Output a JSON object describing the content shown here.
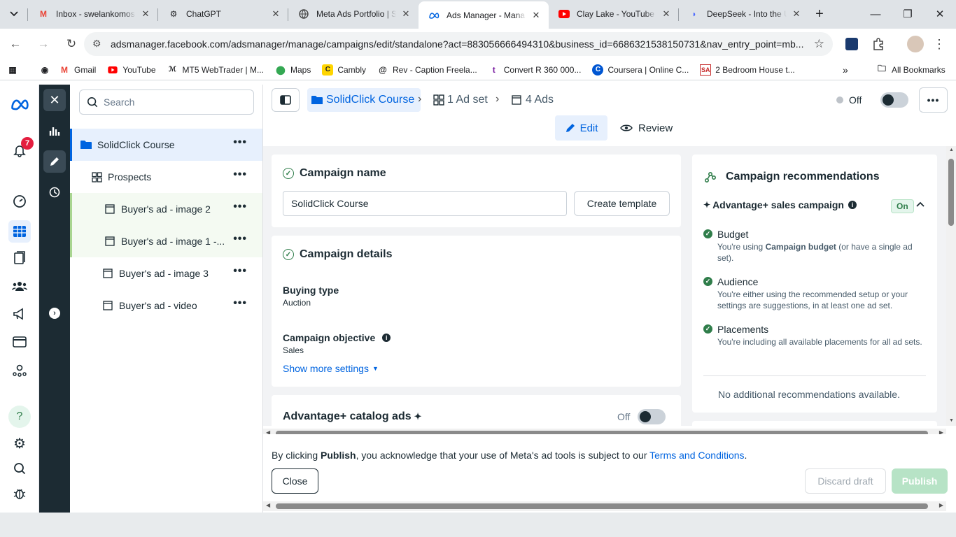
{
  "browser": {
    "tabs": [
      {
        "title": "Inbox - swelankomos",
        "icon": "gmail-icon"
      },
      {
        "title": "ChatGPT",
        "icon": "chatgpt-icon"
      },
      {
        "title": "Meta Ads Portfolio | S",
        "icon": "globe-icon"
      },
      {
        "title": "Ads Manager - Mana",
        "icon": "meta-icon"
      },
      {
        "title": "Clay Lake - YouTube",
        "icon": "youtube-icon"
      },
      {
        "title": "DeepSeek - Into the U",
        "icon": "deepseek-icon"
      }
    ],
    "url": "adsmanager.facebook.com/adsmanager/manage/campaigns/edit/standalone?act=883056666494310&business_id=6686321538150731&nav_entry_point=mb...",
    "bookmarks": [
      "Gmail",
      "YouTube",
      "MT5 WebTrader | M...",
      "Maps",
      "Cambly",
      "Rev - Caption Freela...",
      "Convert R 360 000...",
      "Coursera | Online C...",
      "2 Bedroom House t..."
    ],
    "all_bookmarks": "All Bookmarks"
  },
  "rail": {
    "notifications_count": "7"
  },
  "tree": {
    "search_placeholder": "Search",
    "items": [
      {
        "label": "SolidClick Course"
      },
      {
        "label": "Prospects"
      },
      {
        "label": "Buyer's ad - image 2"
      },
      {
        "label": "Buyer's ad - image 1 -..."
      },
      {
        "label": "Buyer's ad - image 3"
      },
      {
        "label": "Buyer's ad - video"
      }
    ]
  },
  "header": {
    "campaign": "SolidClick Course",
    "adset": "1 Ad set",
    "ads": "4 Ads",
    "status": "Off",
    "edit": "Edit",
    "review": "Review"
  },
  "campaign_name": {
    "title": "Campaign name",
    "value": "SolidClick Course",
    "create_template": "Create template"
  },
  "campaign_details": {
    "title": "Campaign details",
    "buying_type_label": "Buying type",
    "buying_type": "Auction",
    "objective_label": "Campaign objective",
    "objective": "Sales",
    "show_more": "Show more settings"
  },
  "catalog": {
    "title": "Advantage+ catalog ads",
    "status": "Off"
  },
  "recommendations": {
    "title": "Campaign recommendations",
    "subtitle": "Advantage+ sales campaign",
    "badge": "On",
    "items": [
      {
        "title": "Budget",
        "desc_pre": "You're using ",
        "desc_bold": "Campaign budget",
        "desc_post": " (or have a single ad set)."
      },
      {
        "title": "Audience",
        "desc": "You're either using the recommended setup or your settings are suggestions, in at least one ad set."
      },
      {
        "title": "Placements",
        "desc": "You're including all available placements for all ad sets."
      }
    ],
    "none": "No additional recommendations available."
  },
  "footer": {
    "notice_pre": "By clicking ",
    "notice_bold": "Publish",
    "notice_mid": ", you acknowledge that your use of Meta's ad tools is subject to our ",
    "notice_link": "Terms and Conditions",
    "notice_end": ".",
    "close": "Close",
    "discard": "Discard draft",
    "publish": "Publish"
  },
  "colors": {
    "meta_blue": "#0064e0",
    "dark_rail": "#1c2b33",
    "success": "#2f7d4a",
    "publish_disabled": "#b7e3c6"
  }
}
